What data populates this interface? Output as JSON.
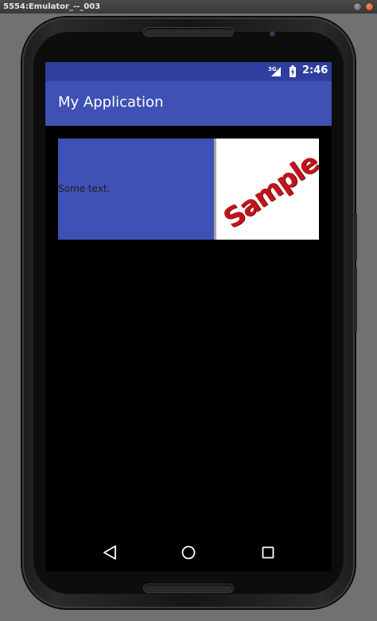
{
  "window": {
    "title": "5554:Emulator_--_003"
  },
  "status_bar": {
    "network": "3G",
    "time": "2:46"
  },
  "app_bar": {
    "title": "My Application"
  },
  "card": {
    "text": "Some text.",
    "image_label": "Sample"
  },
  "icons": {
    "signal": "signal-icon",
    "battery": "battery-charging-icon",
    "back": "back-triangle-icon",
    "home": "home-circle-icon",
    "recent": "recent-apps-square-icon"
  },
  "colors": {
    "status_bar": "#303f9f",
    "app_bar": "#3f51b5",
    "card_left": "#3f51b5",
    "sample_text": "#c0141c"
  }
}
